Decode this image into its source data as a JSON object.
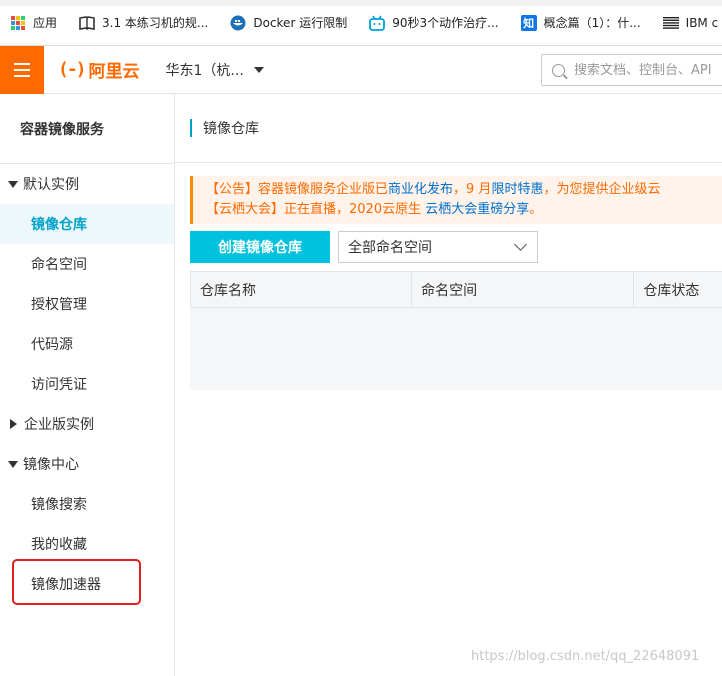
{
  "bookmarks": [
    {
      "label": "应用",
      "icon": "apps-grid-icon"
    },
    {
      "label": "3.1 本练习机的规...",
      "icon": "book-icon"
    },
    {
      "label": "Docker 运行限制",
      "icon": "docker-icon"
    },
    {
      "label": "90秒3个动作治疗...",
      "icon": "bilibili-icon"
    },
    {
      "label": "概念篇（1）：什...",
      "icon": "zhihu-icon"
    },
    {
      "label": "IBM c",
      "icon": "ibm-icon"
    }
  ],
  "header": {
    "logo_text": "阿里云",
    "region": "华东1（杭...",
    "search_placeholder": "搜索文档、控制台、API"
  },
  "sidebar": {
    "title": "容器镜像服务",
    "groups": [
      {
        "label": "默认实例",
        "expanded": true,
        "items": [
          "镜像仓库",
          "命名空间",
          "授权管理",
          "代码源",
          "访问凭证"
        ]
      },
      {
        "label": "企业版实例",
        "expanded": false,
        "items": []
      },
      {
        "label": "镜像中心",
        "expanded": true,
        "items": [
          "镜像搜索",
          "我的收藏",
          "镜像加速器"
        ]
      }
    ],
    "active_item": "镜像仓库"
  },
  "main": {
    "title": "镜像仓库",
    "notice": {
      "line1_prefix": "【公告】容器镜像服务企业版已",
      "line1_link1": "商业化发布",
      "line1_mid": "，9 月",
      "line1_link2": "限时特惠",
      "line1_suffix": "，为您提供企业级云",
      "line2_prefix": "【云栖大会】正在直播，2020云原生 ",
      "line2_link": "云栖大会重磅分享",
      "line2_suffix": "。"
    },
    "create_button": "创建镜像仓库",
    "namespace_select": "全部命名空间",
    "table_headers": [
      "仓库名称",
      "命名空间",
      "仓库状态"
    ]
  },
  "watermark": "https://blog.csdn.net/qq_22648091",
  "colors": {
    "brand_orange": "#ff6a00",
    "accent_cyan": "#00c1de",
    "active_text": "#00a2ca",
    "highlight_red": "#e02020"
  }
}
